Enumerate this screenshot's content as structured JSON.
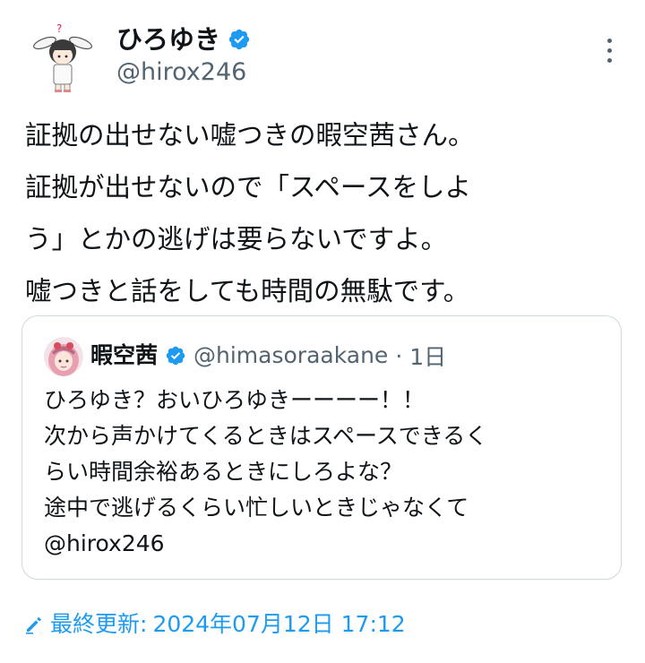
{
  "author": {
    "display_name": "ひろゆき",
    "handle": "@hirox246",
    "verified_icon": "verified-badge-icon",
    "verified_color": "#1d9bf0"
  },
  "more_icon": "more-options-icon",
  "tweet": {
    "lines": [
      "証拠の出せない嘘つきの暇空茜さん。",
      "証拠が出せないので「スペースをしよ",
      "う」とかの逃げは要らないですよ。",
      "嘘つきと話をしても時間の無駄です。"
    ]
  },
  "quote": {
    "display_name": "暇空茜",
    "handle": "@himasoraakane",
    "separator": "·",
    "time": "1日",
    "lines": [
      "ひろゆき？おいひろゆきーーーー！！",
      "次から声かけてくるときはスペースできるく",
      "らい時間余裕あるときにしろよな？",
      "途中で逃げるくらい忙しいときじゃなくて",
      "@hirox246"
    ]
  },
  "edited": {
    "icon": "pencil-icon",
    "label": "最終更新:",
    "date": "2024年07月12日 17:12",
    "color": "#1d9bf0"
  },
  "colors": {
    "text": "#0f1419",
    "secondary": "#536471",
    "accent": "#1d9bf0",
    "border": "#cfd9de"
  }
}
